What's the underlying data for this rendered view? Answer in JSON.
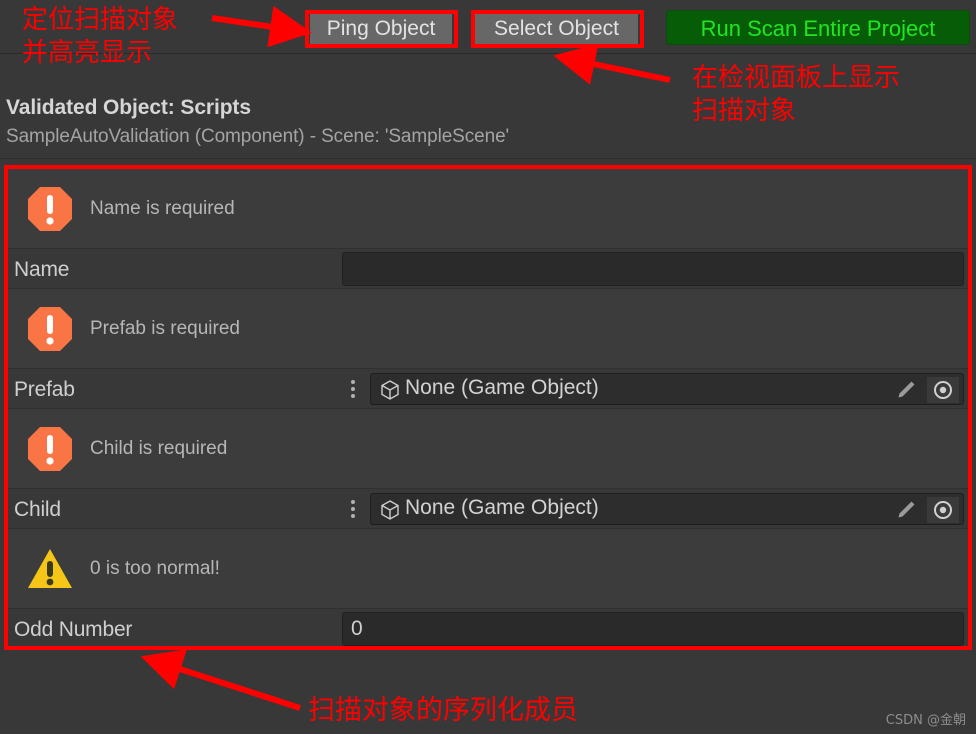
{
  "toolbar": {
    "ping_button": "Ping Object",
    "select_button": "Select Object",
    "scan_button": "Run Scan Entire Project",
    "scan_button_bg": "#075c07",
    "scan_button_fg": "#21e521"
  },
  "header": {
    "title": "Validated Object: Scripts",
    "subtitle": "SampleAutoValidation (Component) - Scene: 'SampleScene'"
  },
  "members": [
    {
      "help": {
        "icon": "error-octagon-icon",
        "severity": "error",
        "color": "#f97545",
        "text": "Name is required"
      },
      "field": {
        "label": "Name",
        "type": "text",
        "value": ""
      }
    },
    {
      "help": {
        "icon": "error-octagon-icon",
        "severity": "error",
        "color": "#f97545",
        "text": "Prefab is required"
      },
      "field": {
        "label": "Prefab",
        "type": "object",
        "value": "None (Game Object)"
      }
    },
    {
      "help": {
        "icon": "error-octagon-icon",
        "severity": "error",
        "color": "#f97545",
        "text": "Child is required"
      },
      "field": {
        "label": "Child",
        "type": "object",
        "value": "None (Game Object)"
      }
    },
    {
      "help": {
        "icon": "warning-triangle-icon",
        "severity": "warning",
        "color": "#f5c518",
        "text": "0 is too normal!"
      },
      "field": {
        "label": "Odd Number",
        "type": "text",
        "value": "0"
      }
    }
  ],
  "annotations": {
    "top_left": "定位扫描对象\n并高亮显示",
    "top_right": "在检视面板上显示\n扫描对象",
    "bottom": "扫描对象的序列化成员",
    "color": "#ff0000"
  },
  "watermark": "CSDN @金朝"
}
